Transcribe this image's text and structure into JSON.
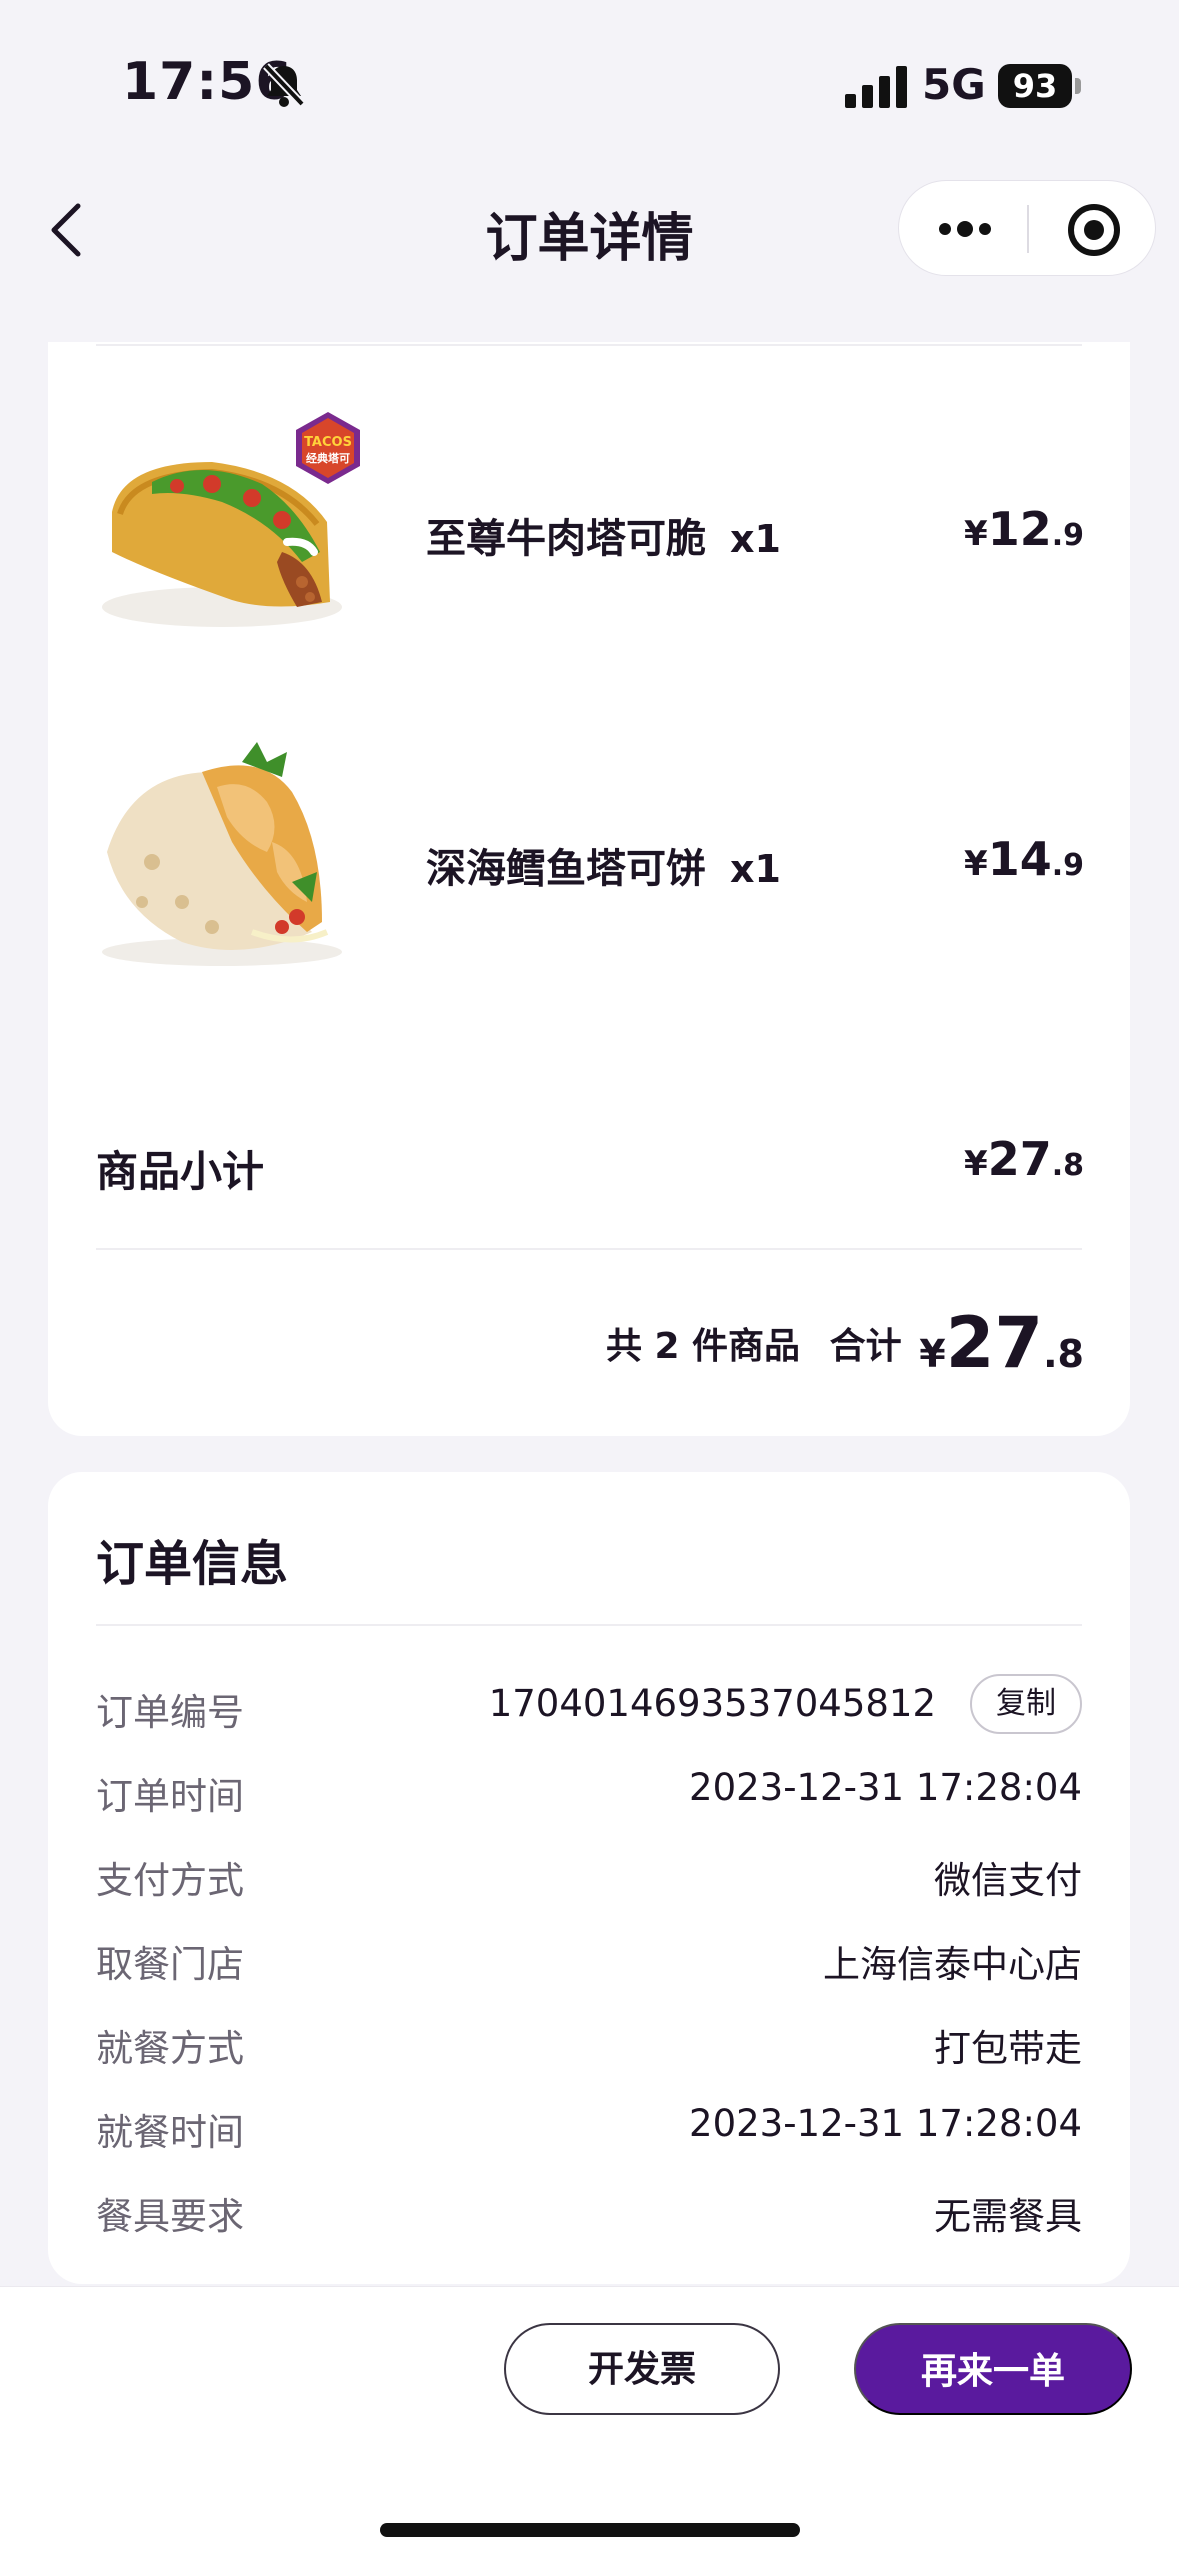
{
  "status_bar": {
    "time": "17:56",
    "network": "5G",
    "battery": "93"
  },
  "nav": {
    "title": "订单详情"
  },
  "items": [
    {
      "name": "至尊牛肉塔可脆",
      "qty": "x1",
      "price_yen": "¥",
      "price_int": "12",
      "price_dec": ".9",
      "badge_top": "TACOS",
      "badge_bottom": "经典塔可",
      "image": "crunchy-beef-taco"
    },
    {
      "name": "深海鳕鱼塔可饼",
      "qty": "x1",
      "price_yen": "¥",
      "price_int": "14",
      "price_dec": ".9",
      "image": "fish-soft-taco"
    }
  ],
  "summary": {
    "subtotal_label": "商品小计",
    "subtotal_yen": "¥",
    "subtotal_int": "27",
    "subtotal_dec": ".8",
    "count_text": "共 2 件商品",
    "total_label": "合计",
    "total_yen": "¥",
    "total_int": "27",
    "total_dec": ".8"
  },
  "order_info": {
    "title": "订单信息",
    "copy_label": "复制",
    "rows": [
      {
        "label": "订单编号",
        "value": "1704014693537045812"
      },
      {
        "label": "订单时间",
        "value": "2023-12-31 17:28:04"
      },
      {
        "label": "支付方式",
        "value": "微信支付"
      },
      {
        "label": "取餐门店",
        "value": "上海信泰中心店"
      },
      {
        "label": "就餐方式",
        "value": "打包带走"
      },
      {
        "label": "就餐时间",
        "value": "2023-12-31 17:28:04"
      },
      {
        "label": "餐具要求",
        "value": "无需餐具"
      }
    ]
  },
  "actions": {
    "invoice": "开发票",
    "reorder": "再来一单"
  },
  "colors": {
    "accent": "#5a1a9e",
    "background": "#f4f3f8",
    "text_primary": "#1c1424",
    "text_secondary": "#6b6673"
  }
}
